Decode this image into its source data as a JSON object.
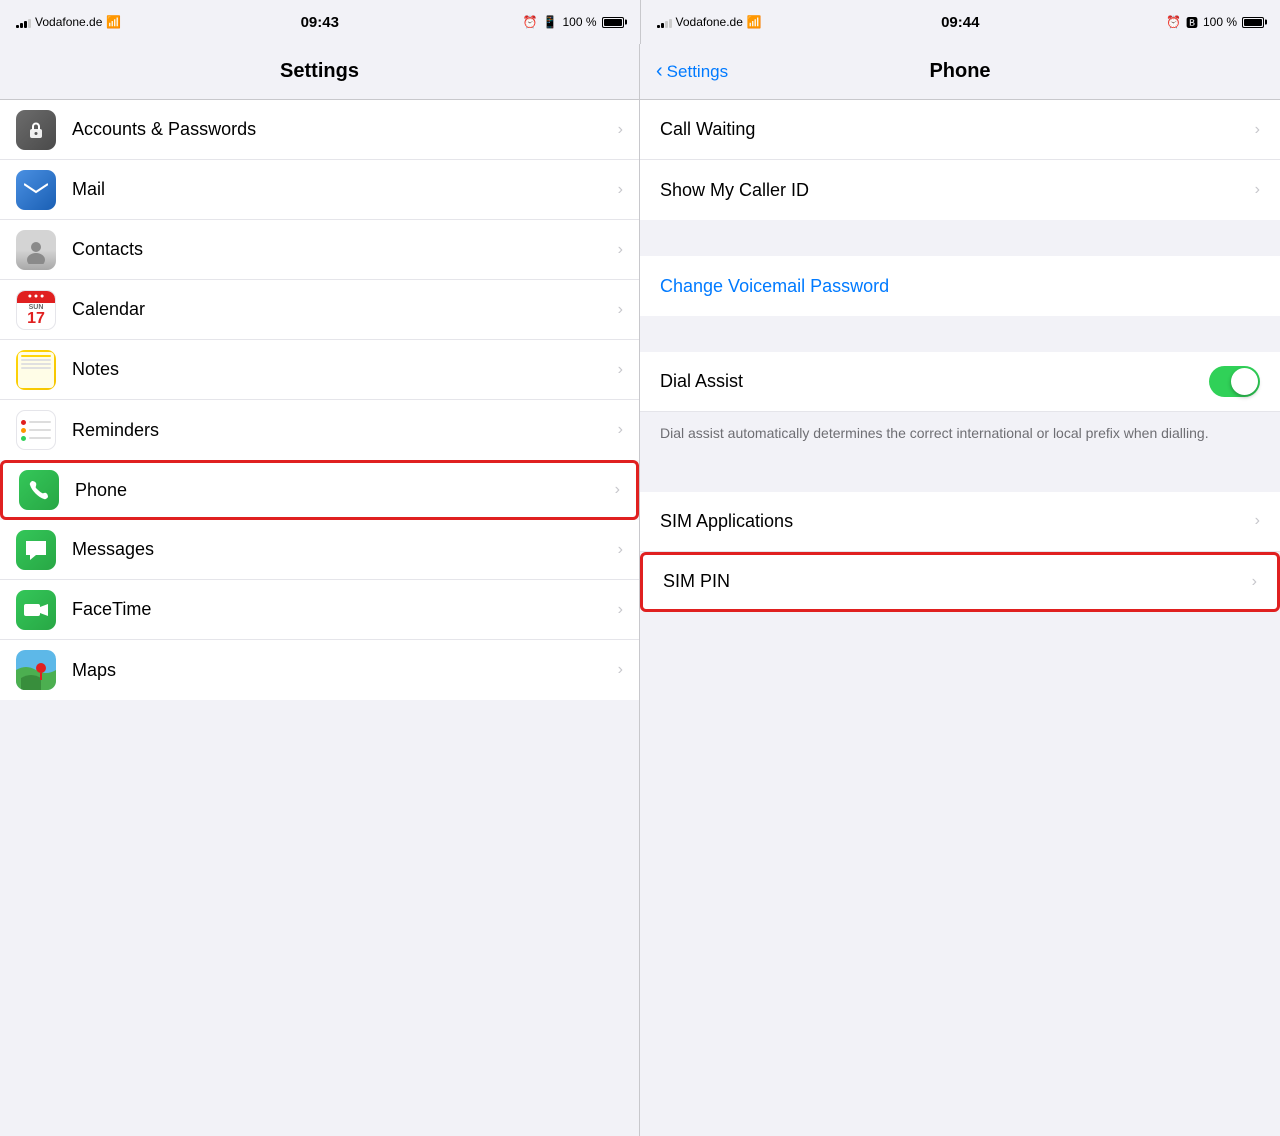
{
  "leftStatusBar": {
    "carrier": "Vodafone.de",
    "time": "09:43",
    "battery": "100 %"
  },
  "rightStatusBar": {
    "carrier": "Vodafone.de",
    "time": "09:44",
    "battery": "100 %"
  },
  "leftPanel": {
    "title": "Settings",
    "items": [
      {
        "id": "accounts-passwords",
        "label": "Accounts & Passwords",
        "icon": "passwords"
      },
      {
        "id": "mail",
        "label": "Mail",
        "icon": "mail"
      },
      {
        "id": "contacts",
        "label": "Contacts",
        "icon": "contacts"
      },
      {
        "id": "calendar",
        "label": "Calendar",
        "icon": "calendar"
      },
      {
        "id": "notes",
        "label": "Notes",
        "icon": "notes"
      },
      {
        "id": "reminders",
        "label": "Reminders",
        "icon": "reminders"
      },
      {
        "id": "phone",
        "label": "Phone",
        "icon": "phone",
        "highlighted": true
      },
      {
        "id": "messages",
        "label": "Messages",
        "icon": "messages"
      },
      {
        "id": "facetime",
        "label": "FaceTime",
        "icon": "facetime"
      },
      {
        "id": "maps",
        "label": "Maps",
        "icon": "maps"
      }
    ]
  },
  "rightPanel": {
    "backLabel": "Settings",
    "title": "Phone",
    "sections": [
      {
        "items": [
          {
            "id": "call-waiting",
            "label": "Call Waiting",
            "type": "nav"
          },
          {
            "id": "show-caller-id",
            "label": "Show My Caller ID",
            "type": "nav"
          }
        ]
      },
      {
        "items": [
          {
            "id": "change-voicemail-password",
            "label": "Change Voicemail Password",
            "type": "action",
            "blue": true
          }
        ]
      },
      {
        "items": [
          {
            "id": "dial-assist",
            "label": "Dial Assist",
            "type": "toggle",
            "value": true
          }
        ]
      },
      {
        "items": [
          {
            "id": "sim-applications",
            "label": "SIM Applications",
            "type": "nav"
          },
          {
            "id": "sim-pin",
            "label": "SIM PIN",
            "type": "nav",
            "highlighted": true
          }
        ]
      }
    ],
    "dialAssistDescription": "Dial assist automatically determines the correct international or local prefix when dialling."
  },
  "icons": {
    "chevronRight": "›",
    "chevronLeft": "‹"
  }
}
